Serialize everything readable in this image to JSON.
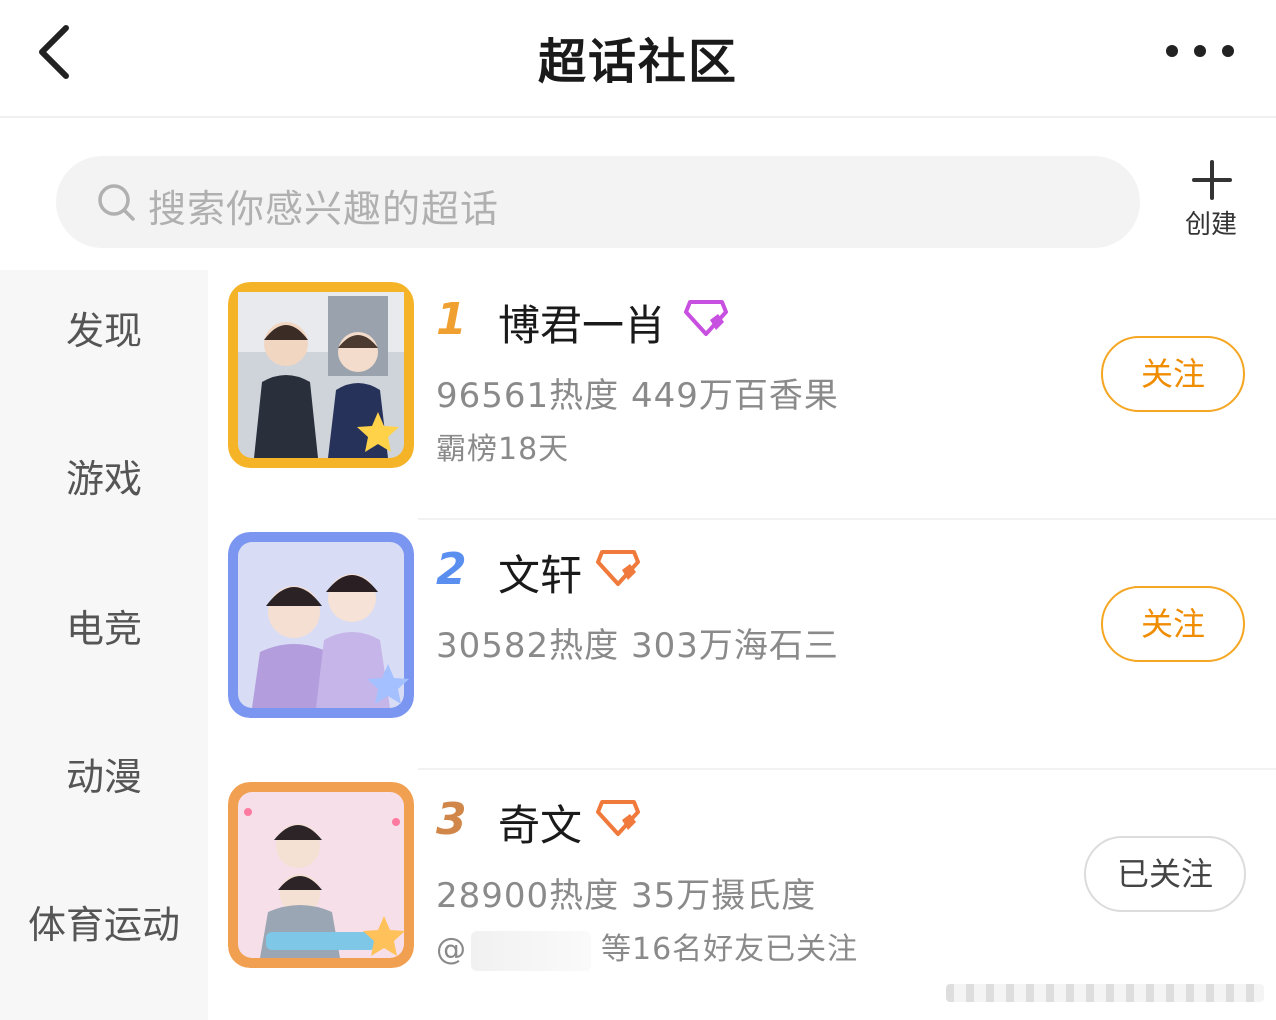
{
  "header": {
    "title": "超话社区",
    "back_icon": "chevron-left-icon",
    "more_icon": "more-dots-icon"
  },
  "search": {
    "placeholder": "搜索你感兴趣的超话",
    "icon": "search-icon"
  },
  "create": {
    "label": "创建",
    "icon": "plus-icon"
  },
  "sidebar": {
    "items": [
      {
        "label": "发现"
      },
      {
        "label": "游戏"
      },
      {
        "label": "电竞"
      },
      {
        "label": "动漫"
      },
      {
        "label": "体育运动"
      }
    ]
  },
  "topics": [
    {
      "rank": "1",
      "rank_color": "#f0a030",
      "name": "博君一肖",
      "badge_color": "#c850e0",
      "stats": "96561热度 449万百香果",
      "sub": "霸榜18天",
      "button": "关注",
      "followed": false,
      "avatar_frame": "#f5b428"
    },
    {
      "rank": "2",
      "rank_color": "#5a8ff0",
      "name": "文轩",
      "badge_color": "#f07a3c",
      "stats": "30582热度 303万海石三",
      "sub": "",
      "button": "关注",
      "followed": false,
      "avatar_frame": "#7b96f0"
    },
    {
      "rank": "3",
      "rank_color": "#d2874a",
      "name": "奇文",
      "badge_color": "#f07a3c",
      "stats": "28900热度 35万摄氏度",
      "sub_prefix": "@",
      "sub": "等16名好友已关注",
      "button": "已关注",
      "followed": true,
      "avatar_frame": "#f0a050"
    }
  ],
  "colors": {
    "accent": "#f5a623",
    "sidebar_bg": "#f7f7f7",
    "muted_text": "#8a8a8a"
  }
}
